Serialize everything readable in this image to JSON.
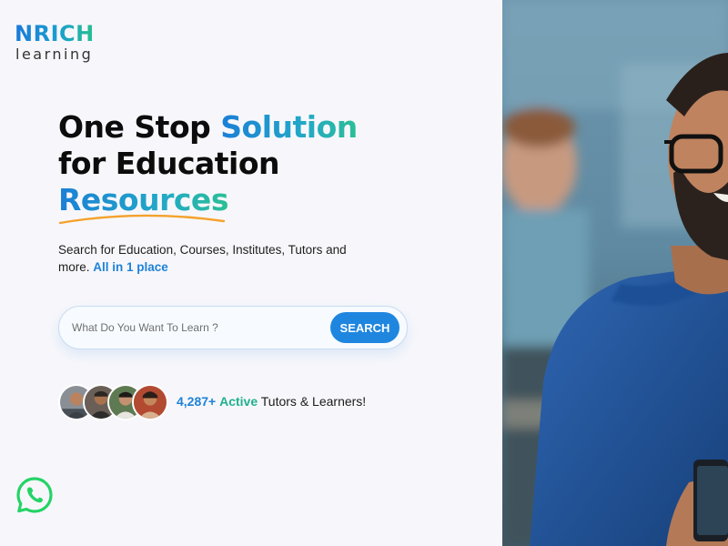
{
  "logo": {
    "brand": "NRICH",
    "sub": "learning"
  },
  "headline": {
    "line1_prefix": "One Stop ",
    "line1_accent": "Solution",
    "line2": "for Education",
    "line3_accent": "Resources"
  },
  "description": {
    "text": "Search for Education, Courses, Institutes, Tutors and more. ",
    "highlight": "All in 1 place"
  },
  "search": {
    "placeholder": "What Do You Want To Learn ?",
    "value": "",
    "button_label": "SEARCH"
  },
  "community": {
    "count": "4,287+",
    "active": "Active",
    "suffix": " Tutors & Learners!"
  },
  "icons": {
    "whatsapp": "whatsapp-icon",
    "avatars": [
      "avatar-1",
      "avatar-2",
      "avatar-3",
      "avatar-4"
    ]
  },
  "colors": {
    "accent_blue": "#1e82d8",
    "accent_green": "#2bbf96",
    "underline_orange": "#f4a22d",
    "whatsapp_green": "#25d366"
  }
}
